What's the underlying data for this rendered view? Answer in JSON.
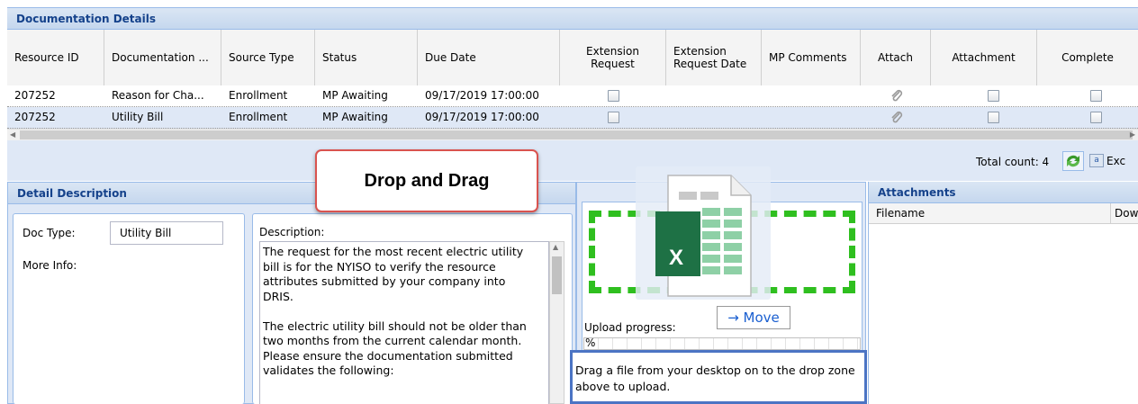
{
  "grid": {
    "title": "Documentation Details",
    "columns": [
      {
        "label": "Resource ID"
      },
      {
        "label": "Documentation ..."
      },
      {
        "label": "Source Type"
      },
      {
        "label": "Status"
      },
      {
        "label": "Due Date"
      },
      {
        "label1": "Extension",
        "label2": "Request"
      },
      {
        "label1": "Extension",
        "label2": "Request Date"
      },
      {
        "label": "MP Comments"
      },
      {
        "label": "Attach"
      },
      {
        "label": "Attachment"
      },
      {
        "label": "Complete"
      }
    ],
    "rows": [
      {
        "resource_id": "207252",
        "documentation": "Reason for Cha...",
        "source_type": "Enrollment",
        "status": "MP Awaiting",
        "due_date": "09/17/2019 17:00:00",
        "extension_request": false,
        "attachment": false,
        "complete": false
      },
      {
        "resource_id": "207252",
        "documentation": "Utility Bill",
        "source_type": "Enrollment",
        "status": "MP Awaiting",
        "due_date": "09/17/2019 17:00:00",
        "extension_request": false,
        "attachment": false,
        "complete": false
      }
    ],
    "total_count": "Total count: 4",
    "export_label": "Exc"
  },
  "detail": {
    "title": "Detail Description",
    "doc_type_label": "Doc Type:",
    "doc_type_value": "Utility Bill",
    "more_info_label": "More Info:",
    "description_label": "Description:",
    "description_text": "The request for the most recent electric utility bill is for the NYISO to verify the resource attributes submitted by your company into DRIS.\n\nThe electric utility bill should not be older than two months from the current calendar month. Please ensure the documentation submitted validates the following:"
  },
  "upload": {
    "progress_label": "Upload progress:",
    "progress_value": "%",
    "hint": "Drag a file from your desktop on to the drop zone above to upload."
  },
  "attachments": {
    "title": "Attachments",
    "columns": [
      "Filename",
      "Dow"
    ]
  },
  "overlay": {
    "callout": "Drop and Drag",
    "move_label": "→ Move",
    "file_icon_letter": "X"
  },
  "colors": {
    "panel_header_text": "#15428b",
    "dropzone_border": "#2fbf1f",
    "callout_border": "#d9534f",
    "hint_border": "#4b74c4",
    "excel_green": "#1e7145"
  }
}
